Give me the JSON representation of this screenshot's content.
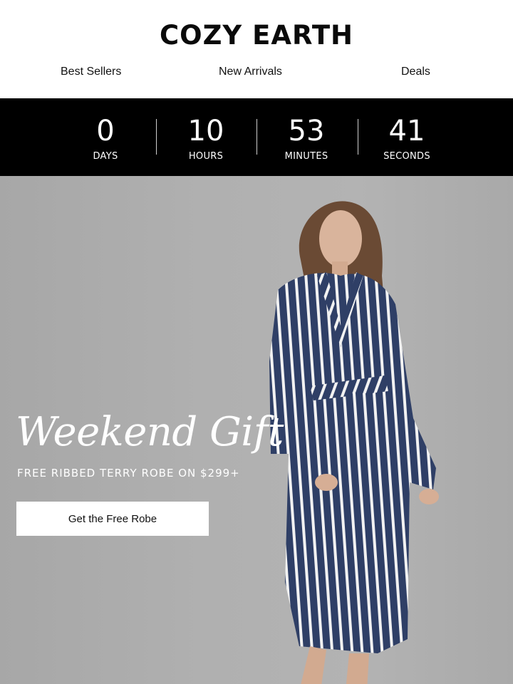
{
  "brand": {
    "logo_text": "COZY EARTH"
  },
  "nav": {
    "items": [
      "Best Sellers",
      "New Arrivals",
      "Deals"
    ]
  },
  "countdown": {
    "units": [
      {
        "value": "0",
        "label": "DAYS"
      },
      {
        "value": "10",
        "label": "HOURS"
      },
      {
        "value": "53",
        "label": "MINUTES"
      },
      {
        "value": "41",
        "label": "SECONDS"
      }
    ]
  },
  "hero": {
    "headline": "Weekend Gift",
    "subline": "FREE RIBBED TERRY ROBE ON $299+",
    "cta_label": "Get the Free Robe",
    "image_subject": "model-in-striped-robe-image"
  },
  "colors": {
    "countdown_bg": "#000000",
    "hero_bg": "#b0b0b0",
    "robe_navy": "#2f3f66",
    "robe_white": "#f2f2f2",
    "cta_bg": "#ffffff"
  }
}
